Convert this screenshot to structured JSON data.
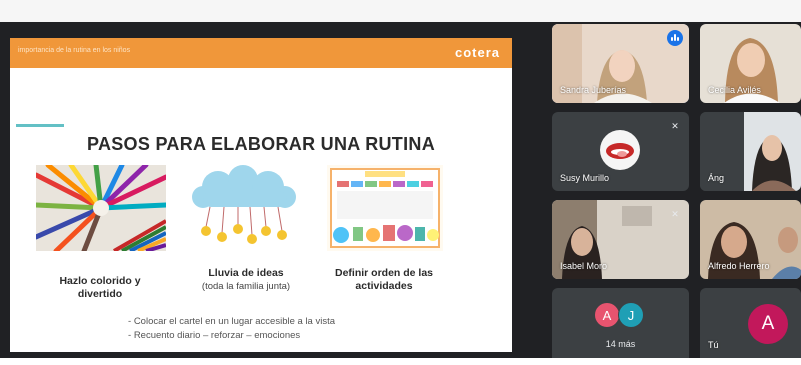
{
  "slide": {
    "header_subtitle": "importancia de la rutina en los niños",
    "brand": "cotera",
    "title": "PASOS PARA ELABORAR UNA RUTINA",
    "items": [
      {
        "label": "Hazlo colorido y divertido",
        "sublabel": ""
      },
      {
        "label": "Lluvia de ideas",
        "sublabel": "(toda la familia junta)"
      },
      {
        "label": "Definir orden de las actividades",
        "sublabel": ""
      }
    ],
    "bullets": [
      "Colocar el cartel en un lugar accesible a la vista",
      "Recuento diario – reforzar – emociones"
    ],
    "colors": {
      "header": "#f0973a",
      "accent_line": "#63c0c5"
    }
  },
  "participants": [
    {
      "name": "Sandra Juberías",
      "muted": false,
      "speaking": true
    },
    {
      "name": "Cecilia Avilés",
      "muted": false,
      "speaking": false
    },
    {
      "name": "Susy Murillo",
      "muted": true,
      "speaking": false
    },
    {
      "name": "Áng",
      "muted": false,
      "speaking": false
    },
    {
      "name": "Isabel Moro",
      "muted": true,
      "speaking": false
    },
    {
      "name": "Alfredo Herrero",
      "muted": false,
      "speaking": false
    }
  ],
  "more": {
    "avatars": [
      "A",
      "J"
    ],
    "label": "14 más"
  },
  "self": {
    "name": "Tú",
    "initial": "A"
  },
  "icons": {
    "muted": "mic-off-icon",
    "speaking": "audio-level-icon"
  }
}
